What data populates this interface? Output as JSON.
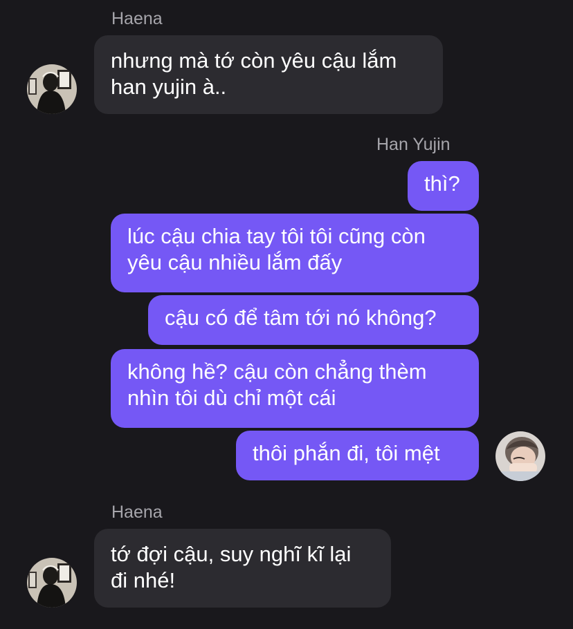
{
  "colors": {
    "background": "#19181c",
    "incoming_bubble": "#2c2b30",
    "outgoing_bubble": "#7558f5",
    "sender_name": "#a6a5ab",
    "message_text": "#ffffff"
  },
  "conversation": {
    "messages": [
      {
        "direction": "incoming",
        "sender": "Haena",
        "text": "nhưng mà tớ còn yêu cậu lắm\nhan yujin à.."
      },
      {
        "direction": "outgoing",
        "sender": "Han Yujin",
        "text": "thì?"
      },
      {
        "direction": "outgoing",
        "text": "lúc cậu chia tay tôi tôi cũng còn\nyêu cậu nhiều lắm đấy"
      },
      {
        "direction": "outgoing",
        "text": "cậu có để tâm tới nó không?"
      },
      {
        "direction": "outgoing",
        "text": "không hề? cậu còn chẳng thèm\nnhìn tôi dù chỉ một cái"
      },
      {
        "direction": "outgoing",
        "text": "thôi phắn đi, tôi mệt"
      },
      {
        "direction": "incoming",
        "sender": "Haena",
        "text": "tớ đợi cậu, suy nghĩ kĩ lại\nđi nhé!"
      }
    ]
  },
  "avatars": {
    "haena": "profile-photo",
    "han_yujin": "profile-photo"
  }
}
